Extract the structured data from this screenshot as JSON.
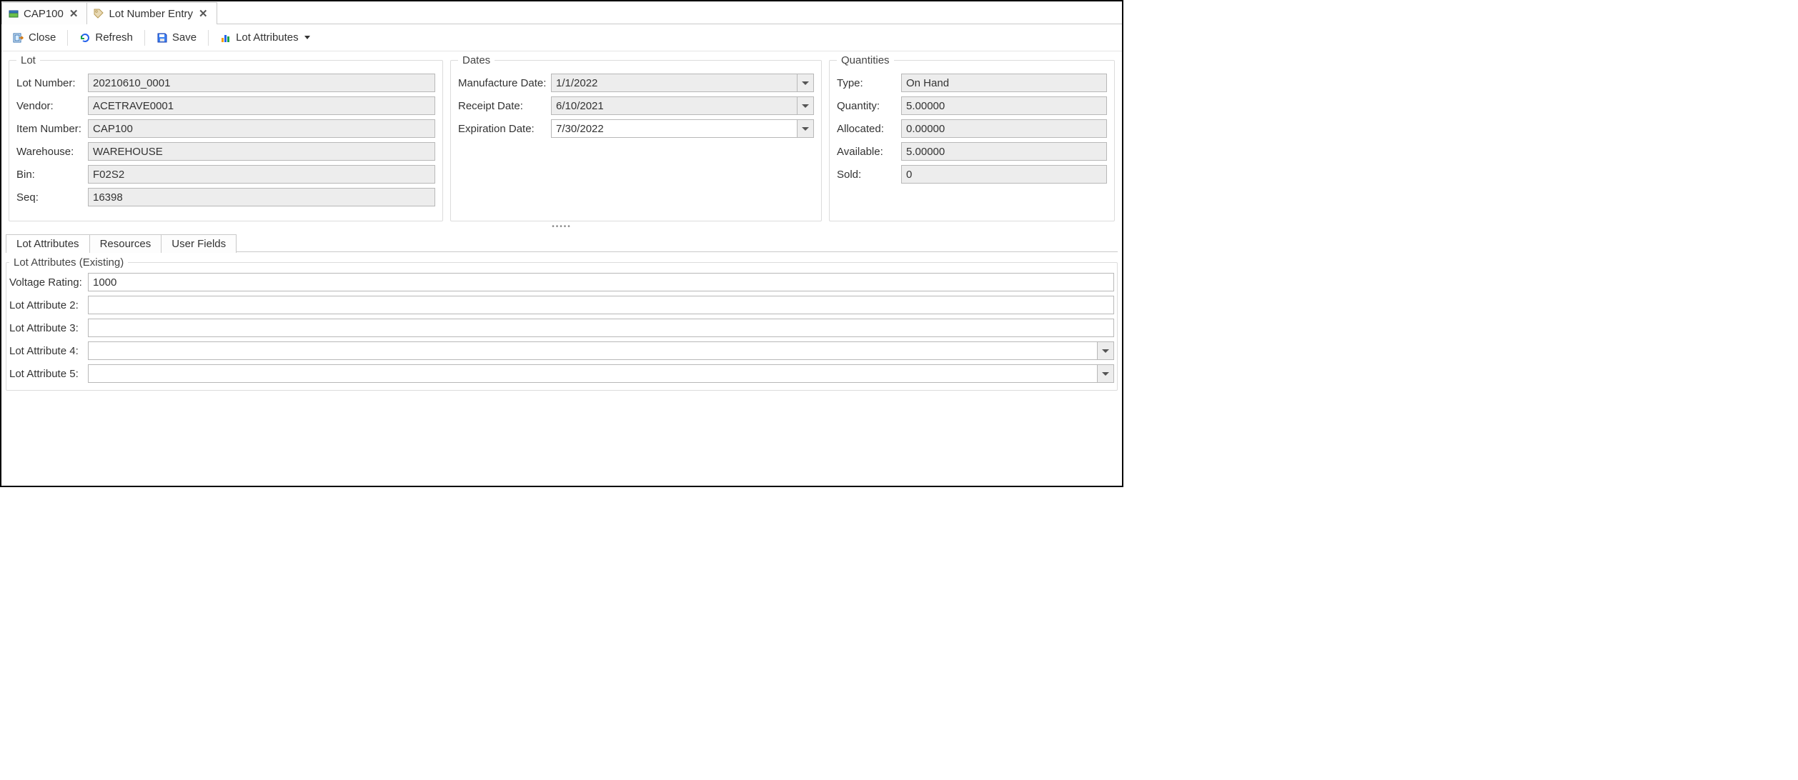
{
  "tabs": [
    {
      "label": "CAP100"
    },
    {
      "label": "Lot Number Entry"
    }
  ],
  "toolbar": {
    "close": "Close",
    "refresh": "Refresh",
    "save": "Save",
    "lot_attributes": "Lot Attributes"
  },
  "groups": {
    "lot": {
      "legend": "Lot",
      "lot_number_label": "Lot Number:",
      "lot_number": "20210610_0001",
      "vendor_label": "Vendor:",
      "vendor": "ACETRAVE0001",
      "item_number_label": "Item Number:",
      "item_number": "CAP100",
      "warehouse_label": "Warehouse:",
      "warehouse": "WAREHOUSE",
      "bin_label": "Bin:",
      "bin": "F02S2",
      "seq_label": "Seq:",
      "seq": "16398"
    },
    "dates": {
      "legend": "Dates",
      "manufacture_label": "Manufacture Date:",
      "manufacture": "1/1/2022",
      "receipt_label": "Receipt Date:",
      "receipt": "6/10/2021",
      "expiration_label": "Expiration Date:",
      "expiration": "7/30/2022"
    },
    "qty": {
      "legend": "Quantities",
      "type_label": "Type:",
      "type": "On Hand",
      "quantity_label": "Quantity:",
      "quantity": "5.00000",
      "allocated_label": "Allocated:",
      "allocated": "0.00000",
      "available_label": "Available:",
      "available": "5.00000",
      "sold_label": "Sold:",
      "sold": "0"
    }
  },
  "subtabs": {
    "lot_attributes": "Lot Attributes",
    "resources": "Resources",
    "user_fields": "User Fields"
  },
  "attributes": {
    "legend": "Lot Attributes (Existing)",
    "voltage_label": "Voltage Rating:",
    "voltage": "1000",
    "attr2_label": "Lot Attribute 2:",
    "attr2": "",
    "attr3_label": "Lot Attribute 3:",
    "attr3": "",
    "attr4_label": "Lot Attribute 4:",
    "attr4": "",
    "attr5_label": "Lot Attribute 5:",
    "attr5": ""
  }
}
